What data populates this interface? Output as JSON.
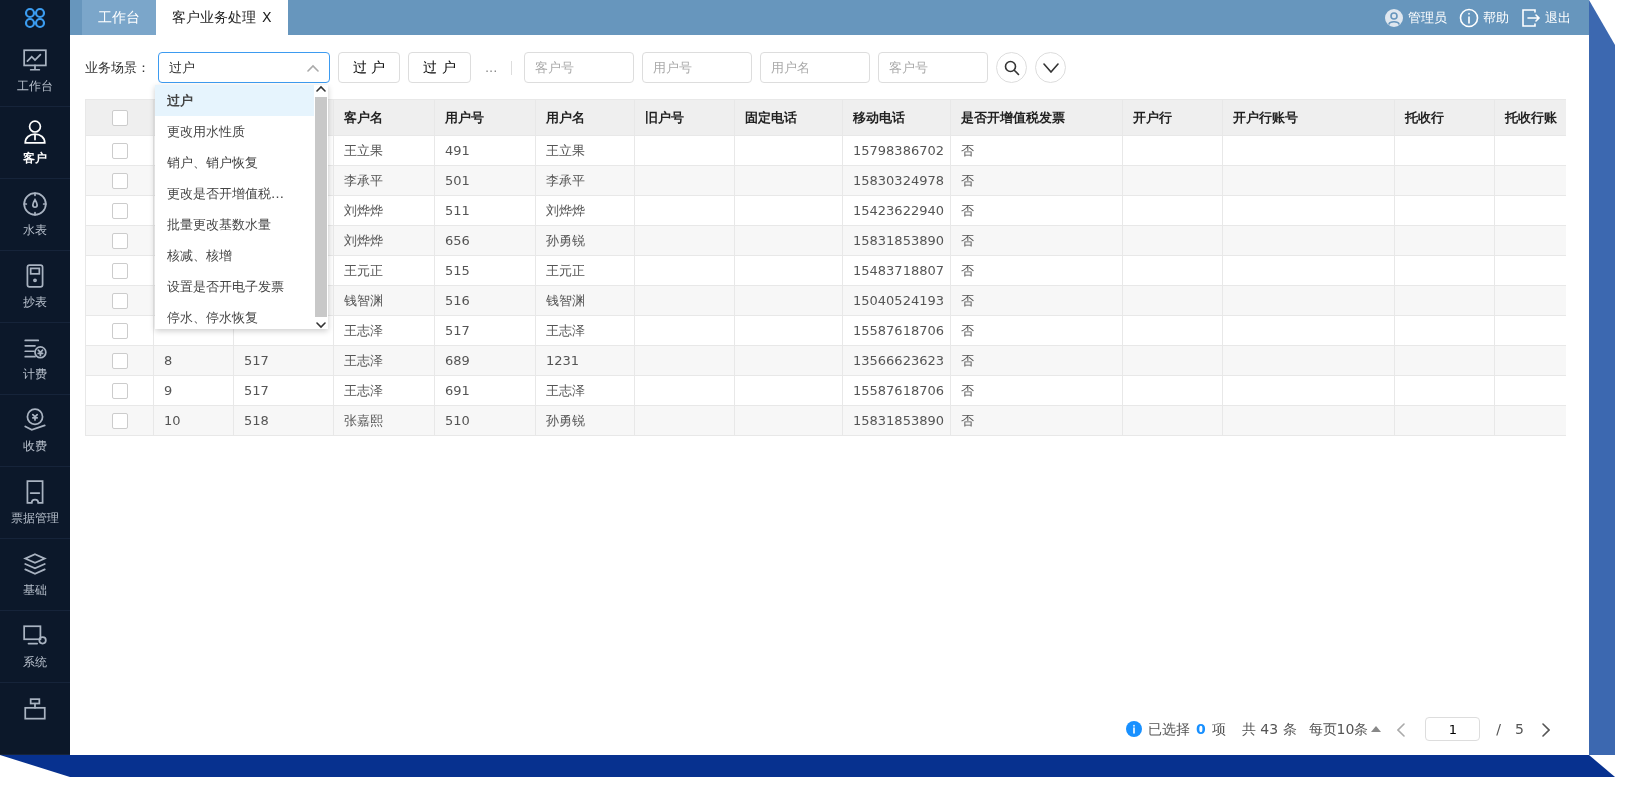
{
  "sidebar": {
    "items": [
      {
        "label": "工作台",
        "selected": false
      },
      {
        "label": "客户",
        "selected": true
      },
      {
        "label": "水表",
        "selected": false
      },
      {
        "label": "抄表",
        "selected": false
      },
      {
        "label": "计费",
        "selected": false
      },
      {
        "label": "收费",
        "selected": false
      },
      {
        "label": "票据管理",
        "selected": false
      },
      {
        "label": "基础",
        "selected": false
      },
      {
        "label": "系统",
        "selected": false
      },
      {
        "selected": false
      }
    ]
  },
  "tabs": [
    {
      "label": "工作台",
      "selected": false
    },
    {
      "label": "客户业务处理",
      "selected": true,
      "close": "X"
    }
  ],
  "user_menu": [
    {
      "label": "管理员"
    },
    {
      "label": "帮助"
    },
    {
      "label": "退出"
    }
  ],
  "filter": {
    "label": "业务场景：",
    "scene": {
      "value": "过户",
      "expanded": true,
      "options": [
        {
          "label": "过户",
          "selected": true
        },
        {
          "label": "更改用水性质",
          "selected": false
        },
        {
          "label": "销户、销户恢复",
          "selected": false
        },
        {
          "label": "更改是否开增值税…",
          "selected": false
        },
        {
          "label": "批量更改基数水量",
          "selected": false
        },
        {
          "label": "核减、核增",
          "selected": false
        },
        {
          "label": "设置是否开电子发票",
          "selected": false
        },
        {
          "label": "停水、停水恢复",
          "selected": false
        }
      ]
    },
    "buttons": [
      "过 户",
      "过 户"
    ],
    "more": "...",
    "fields": [
      {
        "placeholder": "客户号"
      },
      {
        "placeholder": "用户号"
      },
      {
        "placeholder": "用户名"
      },
      {
        "placeholder": "客户号"
      }
    ]
  },
  "table": {
    "all_checked": false,
    "columns": [
      "客户名",
      "用户号",
      "用户名",
      "旧户号",
      "固定电话",
      "移动电话",
      "是否开增值税发票",
      "开户行",
      "开户行账号",
      "托收行",
      "托收行账"
    ],
    "rows": [
      {
        "checked": false,
        "cells": [
          "王立果",
          "491",
          "王立果",
          null,
          null,
          "15798386702",
          "否",
          null,
          null,
          null,
          null
        ]
      },
      {
        "checked": false,
        "cells": [
          "李承平",
          "501",
          "李承平",
          null,
          null,
          "15830324978",
          "否",
          null,
          null,
          null,
          null
        ]
      },
      {
        "checked": false,
        "cells": [
          "刘烨烨",
          "511",
          "刘烨烨",
          null,
          null,
          "15423622940",
          "否",
          null,
          null,
          null,
          null
        ]
      },
      {
        "checked": false,
        "cells": [
          "刘烨烨",
          "656",
          "孙勇锐",
          null,
          null,
          "15831853890",
          "否",
          null,
          null,
          null,
          null
        ]
      },
      {
        "checked": false,
        "cells": [
          "王元正",
          "515",
          "王元正",
          null,
          null,
          "15483718807",
          "否",
          null,
          null,
          null,
          null
        ]
      },
      {
        "checked": false,
        "cells": [
          "钱智渊",
          "516",
          "钱智渊",
          null,
          null,
          "15040524193",
          "否",
          null,
          null,
          null,
          null
        ]
      },
      {
        "checked": false,
        "cells": [
          "王志泽",
          "517",
          "王志泽",
          null,
          null,
          "15587618706",
          "否",
          null,
          null,
          null,
          null
        ]
      },
      {
        "checked": false,
        "lead": [
          "8",
          "517"
        ],
        "cells": [
          "王志泽",
          "689",
          "1231",
          null,
          null,
          "13566623623",
          "否",
          null,
          null,
          null,
          null
        ]
      },
      {
        "checked": false,
        "lead": [
          "9",
          "517"
        ],
        "cells": [
          "王志泽",
          "691",
          "王志泽",
          null,
          null,
          "15587618706",
          "否",
          null,
          null,
          null,
          null
        ]
      },
      {
        "checked": false,
        "lead": [
          "10",
          "518"
        ],
        "cells": [
          "张嘉熙",
          "510",
          "孙勇锐",
          null,
          null,
          "15831853890",
          "否",
          null,
          null,
          null,
          null
        ]
      }
    ]
  },
  "pagination": {
    "selected_label": "已选择",
    "selected_count": "0",
    "selected_unit": "项",
    "total": "共 43 条",
    "page_size": "每页10条",
    "page": "1",
    "slash": "/",
    "pages": "5"
  }
}
